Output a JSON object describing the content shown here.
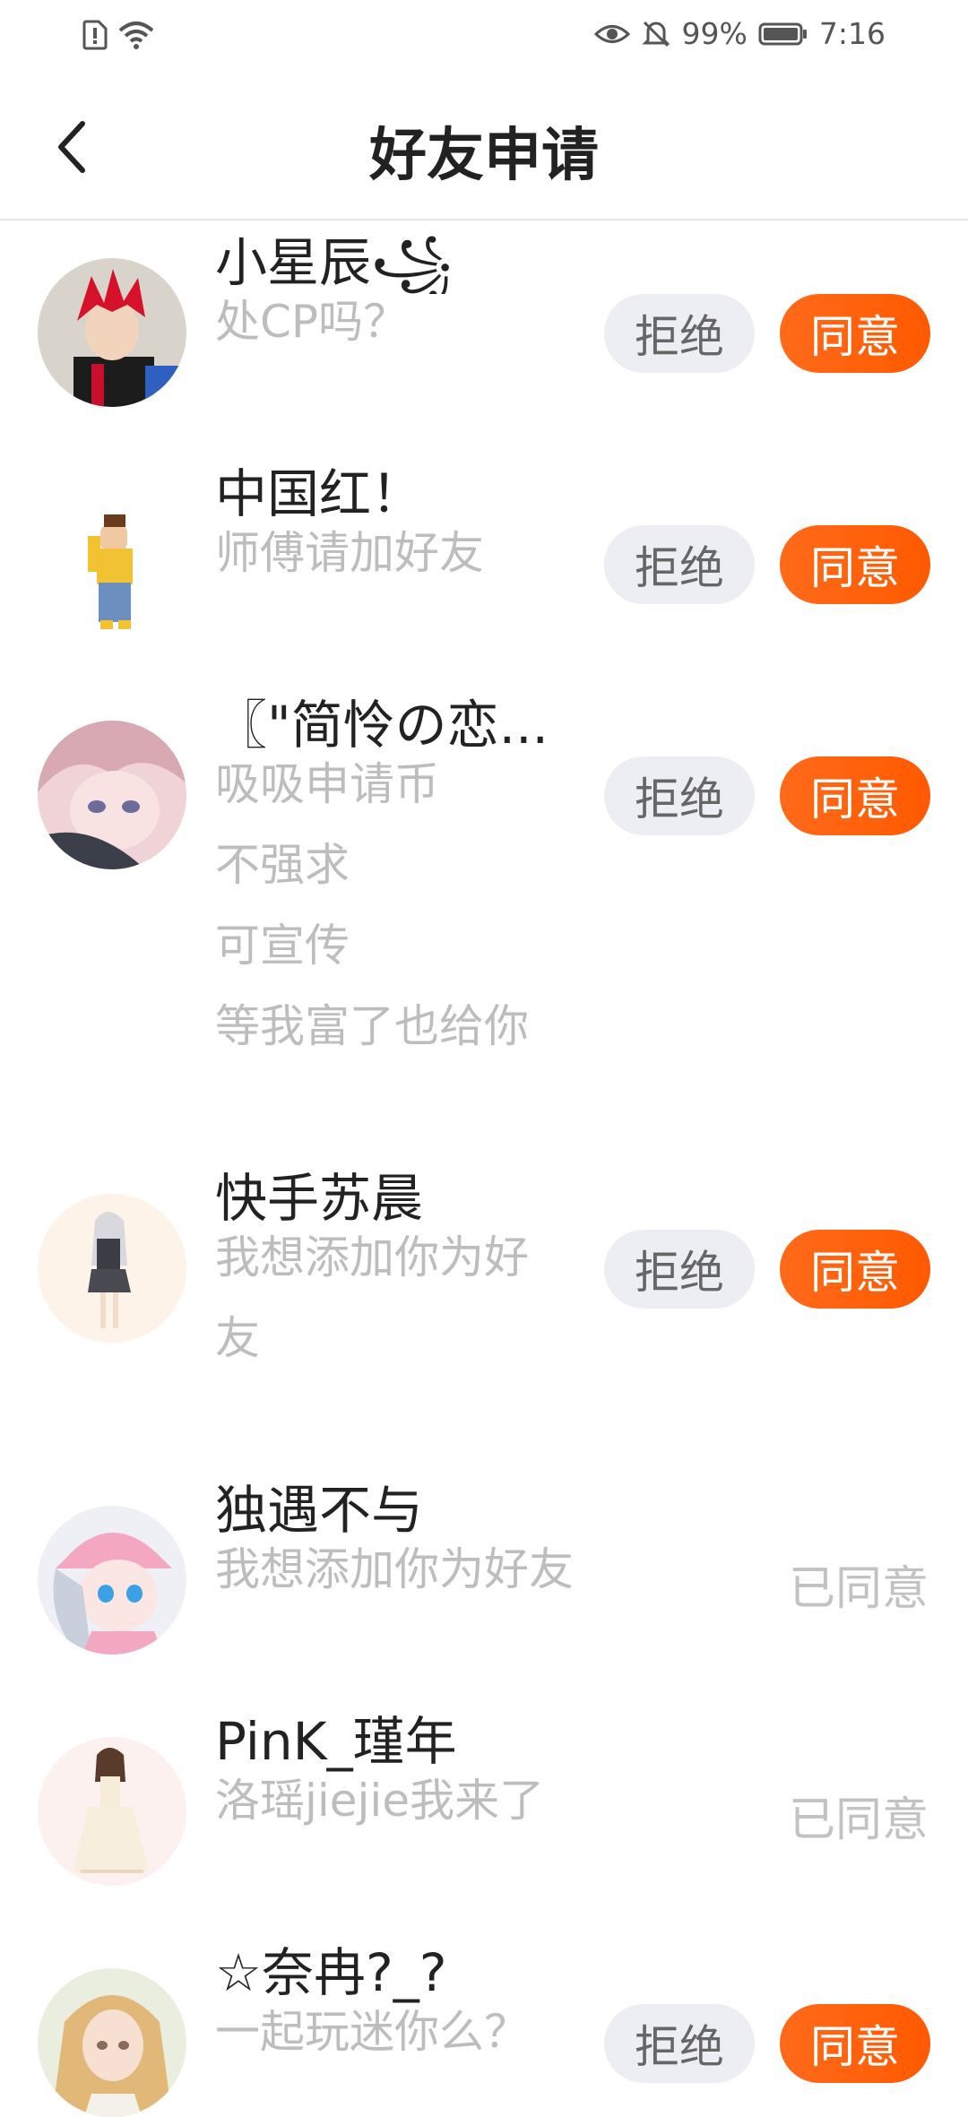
{
  "status_bar": {
    "battery": "99%",
    "time": "7:16"
  },
  "header": {
    "title": "好友申请"
  },
  "colors": {
    "accent": "#ff5a00",
    "reject_bg": "#eceef3",
    "muted_text": "#bdbdbd"
  },
  "requests": [
    {
      "name": "小星辰꧁",
      "message_lines": [
        "处CP吗？"
      ],
      "reject_label": "拒绝",
      "accept_label": "同意",
      "avatar": "red-hair-character-avatar"
    },
    {
      "name": "中国红！",
      "message_lines": [
        "师傅请加好友"
      ],
      "reject_label": "拒绝",
      "accept_label": "同意",
      "avatar": "standing-character-avatar"
    },
    {
      "name": "〖\"简怜の恋...",
      "message_lines": [
        "吸吸申请币",
        "不强求",
        "可宣传",
        "等我富了也给你"
      ],
      "reject_label": "拒绝",
      "accept_label": "同意",
      "avatar": "anime-girl-avatar"
    },
    {
      "name": "快手苏晨",
      "message_lines": [
        "我想添加你为好",
        "友"
      ],
      "reject_label": "拒绝",
      "accept_label": "同意",
      "avatar": "doll-girl-avatar"
    },
    {
      "name": "独遇不与",
      "message_lines": [
        "我想添加你为好友"
      ],
      "status_label": "已同意",
      "avatar": "pink-hat-girl-avatar"
    },
    {
      "name": "PinK_瑾年",
      "message_lines": [
        "洛瑶jiejie我来了"
      ],
      "status_label": "已同意",
      "avatar": "white-dress-girl-avatar"
    },
    {
      "name": "☆奈冉?_?",
      "message_lines": [
        "一起玩迷你么？"
      ],
      "reject_label": "拒绝",
      "accept_label": "同意",
      "avatar": "blonde-girl-avatar"
    }
  ]
}
